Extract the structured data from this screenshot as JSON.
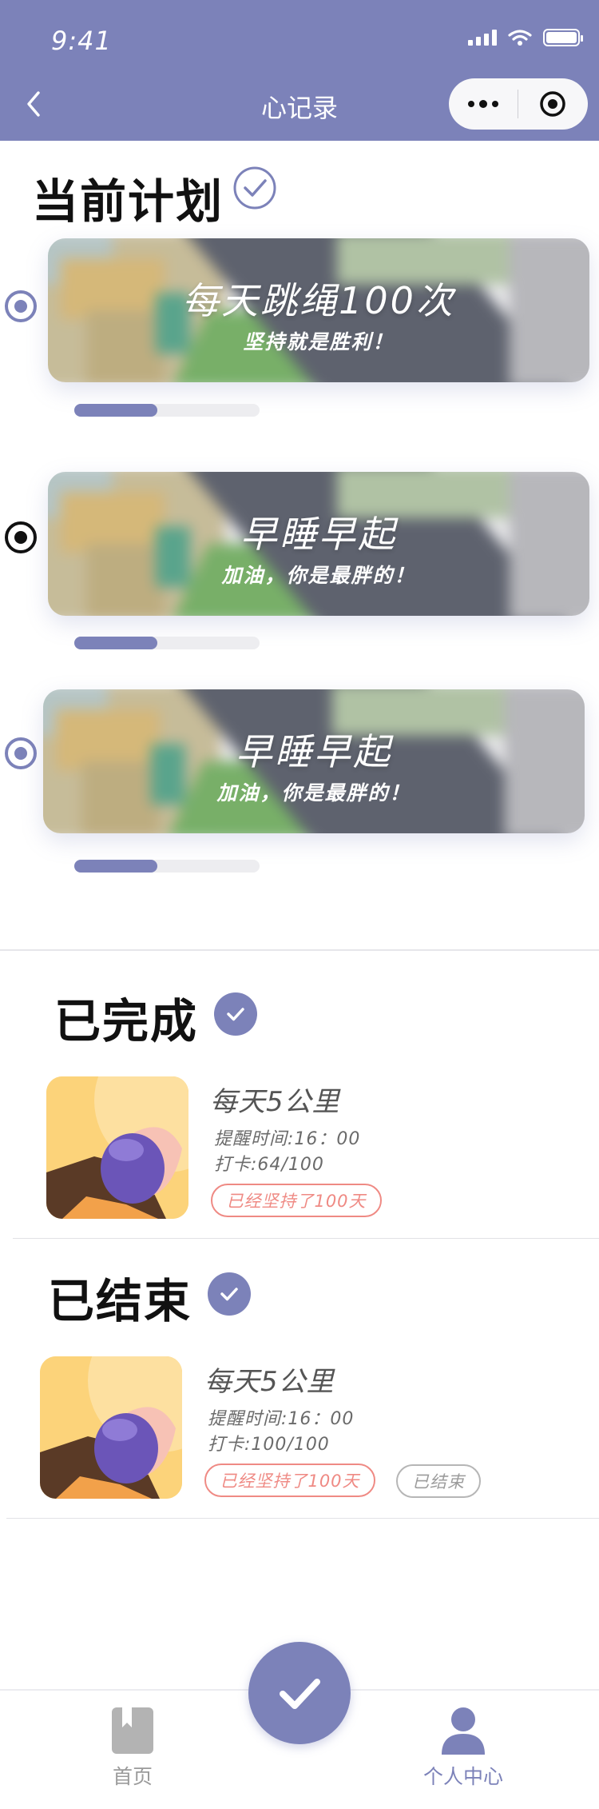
{
  "status_bar": {
    "time": "9:41"
  },
  "nav": {
    "title": "心记录"
  },
  "current": {
    "title": "当前计划",
    "plans": [
      {
        "name": "每天跳绳100次",
        "motto": "坚持就是胜利！",
        "progress": 0.45,
        "selected": false
      },
      {
        "name": "早睡早起",
        "motto": "加油，你是最胖的！",
        "progress": 0.45,
        "selected": true
      },
      {
        "name": "早睡早起",
        "motto": "加油，你是最胖的！",
        "progress": 0.45,
        "selected": false
      }
    ]
  },
  "completed": {
    "title": "已完成",
    "item": {
      "title": "每天5公里",
      "reminder": "提醒时间:16：00",
      "checkin": "打卡:64/100",
      "tag": "已经坚持了100天"
    }
  },
  "ended": {
    "title": "已结束",
    "item": {
      "title": "每天5公里",
      "reminder": "提醒时间:16：00",
      "checkin": "打卡:100/100",
      "tag": "已经坚持了100天",
      "status_tag": "已结束"
    }
  },
  "tabbar": {
    "home": "首页",
    "profile": "个人中心",
    "active": "profile"
  },
  "colors": {
    "accent": "#7c82b9",
    "tag_red": "#ef8a84"
  }
}
